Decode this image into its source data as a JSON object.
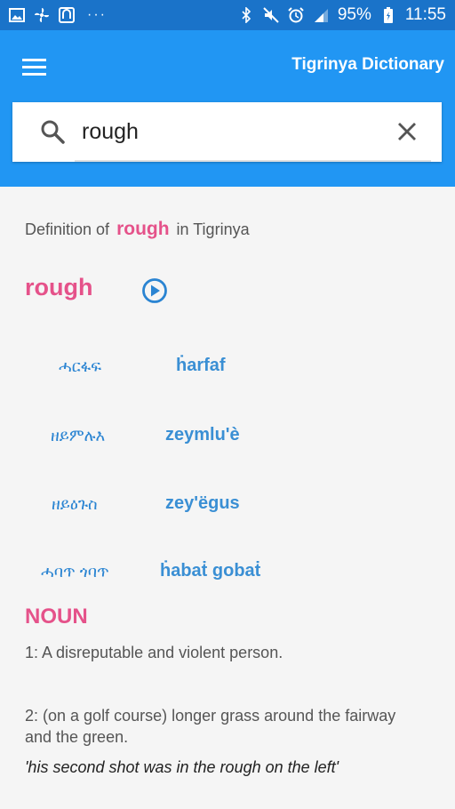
{
  "status_bar": {
    "battery": "95%",
    "time": "11:55",
    "icons_left": [
      "image-icon",
      "fan-icon",
      "app-icon",
      "more-dots-icon"
    ],
    "icons_right": [
      "bluetooth-icon",
      "mute-icon",
      "alarm-icon",
      "signal-icon",
      "battery-icon"
    ]
  },
  "app_bar": {
    "title": "Tigrinya Dictionary",
    "menu_icon": "menu-icon"
  },
  "search": {
    "value": "rough",
    "search_icon": "search-icon",
    "clear_icon": "close-icon"
  },
  "definition_header": {
    "prefix": "Definition of",
    "word": "rough",
    "suffix": "in Tigrinya"
  },
  "entry": {
    "headword": "rough",
    "play_icon": "play-circle-icon",
    "translations": [
      {
        "geez": "ሓርፋፍ",
        "latin": "ḣarfaf"
      },
      {
        "geez": "ዘይምሉእ",
        "latin": "zeymlu'è"
      },
      {
        "geez": "ዘይዕጉስ",
        "latin": "zey'ëgus"
      },
      {
        "geez": "ሓባጥ ጎባጥ",
        "latin": "ḣabaṫ gobaṫ"
      }
    ]
  },
  "part_of_speech": "NOUN",
  "senses": [
    {
      "text": "1:  A disreputable and violent person."
    },
    {
      "text": "2:  (on a golf course) longer grass around the fairway and the green.",
      "example": "'his second shot was in the rough on the left'"
    }
  ],
  "colors": {
    "status_bar": "#1a73c9",
    "app_bar": "#2196f3",
    "accent_pink": "#e5528a",
    "link_blue": "#2a84d2"
  }
}
